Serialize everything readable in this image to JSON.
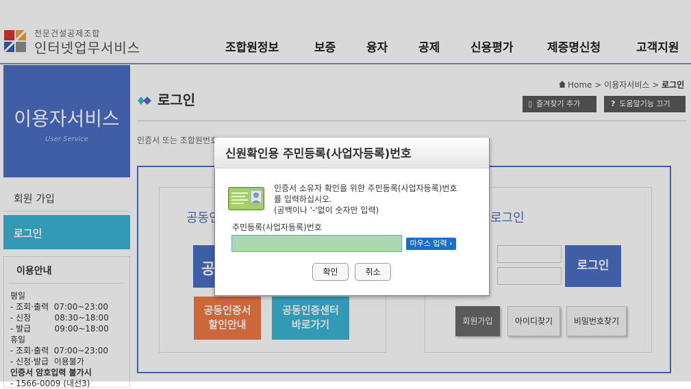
{
  "header": {
    "logo_small": "전문건설공제조합",
    "logo_main": "인터넷업무서비스",
    "nav": [
      "조합원정보",
      "보증",
      "융자",
      "공제",
      "신용평가",
      "제증명신청",
      "고객지원"
    ]
  },
  "sidebar": {
    "hero_title": "이용자서비스",
    "hero_sub": "User Service",
    "items": [
      {
        "label": "회원 가입"
      },
      {
        "label": "로그인"
      }
    ],
    "info": {
      "title": "이용안내",
      "lines": [
        "평일",
        "- 조회·출력  07:00~23:00",
        "- 신청         08:30~18:00",
        "- 발급         09:00~18:00",
        "휴일",
        "- 조회·출력  07:00~23:00",
        "- 신청·발급  이용불가",
        "인증서 암호입력 불가시",
        "- 1566-0009 (내선3)"
      ]
    }
  },
  "breadcrumb": {
    "home": "Home",
    "sep": ">",
    "section": "이용자서비스",
    "current": "로그인"
  },
  "page": {
    "title": "로그인",
    "bookmark_btn": "즐겨찾기 추가",
    "help_btn": "도움말기능 끄기",
    "intro": "인증서 또는 조합원번호"
  },
  "cert_login": {
    "heading": "공동인",
    "login_label": "공",
    "discount": "공동인증서\n할인안내",
    "center": "공동인증센터\n바로가기"
  },
  "id_login": {
    "heading": "로그인",
    "login_btn": "로그인",
    "join_btn": "회원가입",
    "find_id_btn": "아이디찾기",
    "find_pw_btn": "비밀번호찾기"
  },
  "dialog": {
    "title": "신원확인용 주민등록(사업자등록)번호",
    "message_1": "인증서 소유자 확인을 위한 주민등록(사업자등록)번호",
    "message_2": "를 입력하십시오.",
    "message_3": "(공백이나 '-'없이 숫자만 입력)",
    "field_label": "주민등록(사업자등록)번호",
    "input_value": "",
    "mouse_btn": "마우스 입력 ›",
    "ok_btn": "확인",
    "cancel_btn": "취소"
  },
  "colors": {
    "brand_blue": "#4a6fc4",
    "accent_cyan": "#3cb6d6",
    "accent_orange": "#f07a45",
    "input_green": "#acd8b0",
    "mouse_btn_blue": "#1a6fc9"
  }
}
